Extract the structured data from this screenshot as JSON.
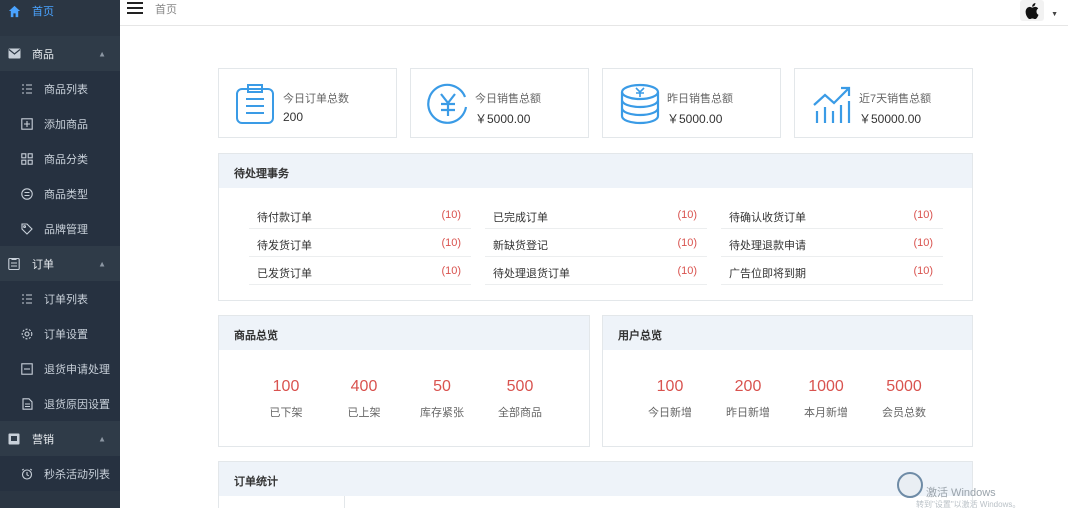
{
  "sidebar": {
    "items": [
      {
        "label": "首页",
        "icon": "home-icon"
      },
      {
        "label": "商品",
        "icon": "mail-icon"
      },
      {
        "label": "商品列表",
        "icon": "list-icon"
      },
      {
        "label": "添加商品",
        "icon": "plus-square-icon"
      },
      {
        "label": "商品分类",
        "icon": "grid-icon"
      },
      {
        "label": "商品类型",
        "icon": "circle-list-icon"
      },
      {
        "label": "品牌管理",
        "icon": "tag-icon"
      },
      {
        "label": "订单",
        "icon": "clipboard-icon"
      },
      {
        "label": "订单列表",
        "icon": "list-icon"
      },
      {
        "label": "订单设置",
        "icon": "gear-icon"
      },
      {
        "label": "退货申请处理",
        "icon": "box-icon"
      },
      {
        "label": "退货原因设置",
        "icon": "doc-icon"
      },
      {
        "label": "营销",
        "icon": "marketing-icon"
      },
      {
        "label": "秒杀活动列表",
        "icon": "alarm-icon"
      }
    ]
  },
  "topbar": {
    "breadcrumb": "首页"
  },
  "stats": [
    {
      "label": "今日订单总数",
      "value": "200",
      "icon": "clipboard-icon"
    },
    {
      "label": "今日销售总额",
      "value": "￥5000.00",
      "icon": "yen-icon"
    },
    {
      "label": "昨日销售总额",
      "value": "￥5000.00",
      "icon": "coins-icon"
    },
    {
      "label": "近7天销售总额",
      "value": "￥50000.00",
      "icon": "growth-chart-icon"
    }
  ],
  "todo": {
    "title": "待处理事务",
    "rows": [
      [
        {
          "label": "待付款订单",
          "count": "(10)"
        },
        {
          "label": "已完成订单",
          "count": "(10)"
        },
        {
          "label": "待确认收货订单",
          "count": "(10)"
        }
      ],
      [
        {
          "label": "待发货订单",
          "count": "(10)"
        },
        {
          "label": "新缺货登记",
          "count": "(10)"
        },
        {
          "label": "待处理退款申请",
          "count": "(10)"
        }
      ],
      [
        {
          "label": "已发货订单",
          "count": "(10)"
        },
        {
          "label": "待处理退货订单",
          "count": "(10)"
        },
        {
          "label": "广告位即将到期",
          "count": "(10)"
        }
      ]
    ]
  },
  "product_overview": {
    "title": "商品总览",
    "items": [
      {
        "value": "100",
        "label": "已下架"
      },
      {
        "value": "400",
        "label": "已上架"
      },
      {
        "value": "50",
        "label": "库存紧张"
      },
      {
        "value": "500",
        "label": "全部商品"
      }
    ]
  },
  "user_overview": {
    "title": "用户总览",
    "items": [
      {
        "value": "100",
        "label": "今日新增"
      },
      {
        "value": "200",
        "label": "昨日新增"
      },
      {
        "value": "1000",
        "label": "本月新增"
      },
      {
        "value": "5000",
        "label": "会员总数"
      }
    ]
  },
  "order_stats": {
    "title": "订单统计"
  },
  "watermark": {
    "text": "激活 Windows",
    "subtext": "转到\"设置\"以激活 Windows。"
  },
  "colors": {
    "sidebar_bg": "#2b3643",
    "accent": "#4aa3ff",
    "count_red": "#d9534f",
    "panel_head": "#eef3f9"
  }
}
